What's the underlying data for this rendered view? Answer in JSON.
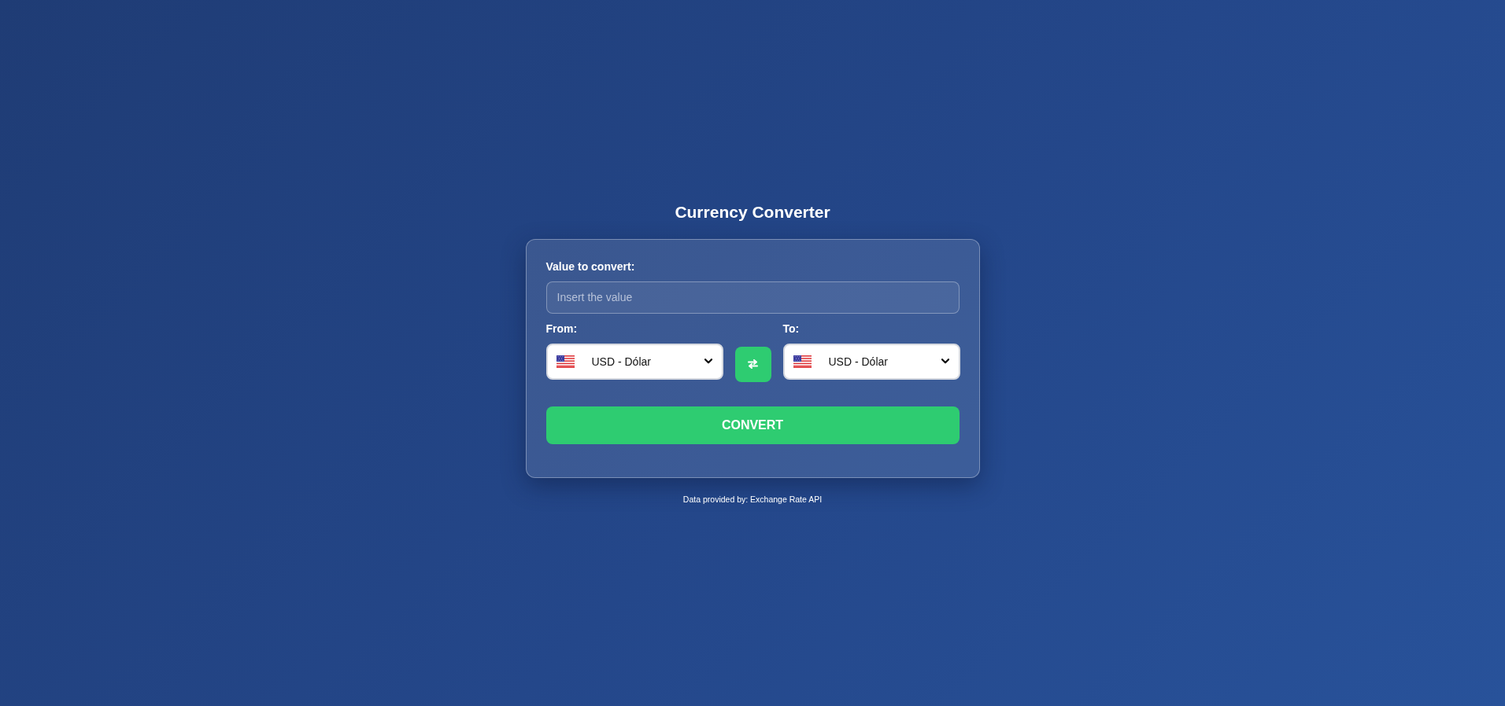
{
  "title": "Currency Converter",
  "form": {
    "value_label": "Value to convert:",
    "value_field": {
      "placeholder": "Insert the value"
    },
    "from": {
      "label": "From:",
      "currency": "USD - Dólar"
    },
    "to": {
      "label": "To:",
      "currency": "USD - Dólar"
    },
    "convert_button": "CONVERT"
  },
  "footer": "Data provided by: Exchange Rate API"
}
